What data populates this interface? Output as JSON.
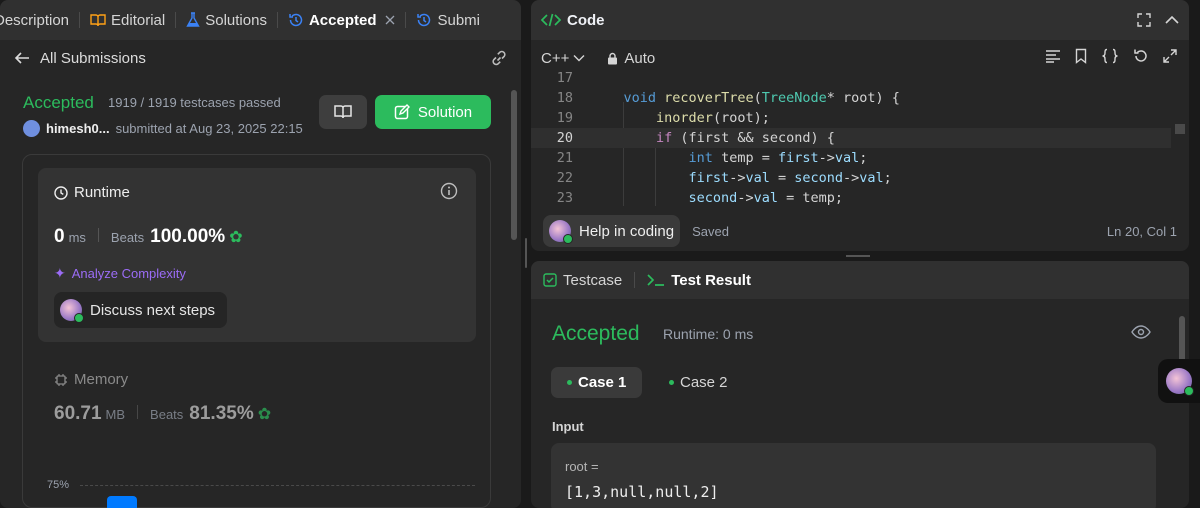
{
  "colors": {
    "accent_green": "#2cbb5d",
    "link_blue": "#3b82f6",
    "purple": "#9b6cf6",
    "chart_bar": "#007aff"
  },
  "left_tabs": [
    {
      "label": "Description",
      "icon": "description-icon"
    },
    {
      "label": "Editorial",
      "icon": "book-icon"
    },
    {
      "label": "Solutions",
      "icon": "flask-icon"
    },
    {
      "label": "Accepted",
      "icon": "history-icon"
    },
    {
      "label": "Submi",
      "icon": "history-icon"
    }
  ],
  "submission": {
    "back_label": "All Submissions",
    "status": "Accepted",
    "testcases": "1919 / 1919 testcases passed",
    "username": "himesh0...",
    "submitted": "submitted at Aug 23, 2025 22:15",
    "solution_button": "Solution",
    "runtime_title": "Runtime",
    "runtime_value": "0",
    "runtime_unit": "ms",
    "beats_label": "Beats",
    "runtime_beats": "100.00%",
    "analyze_label": "Analyze Complexity",
    "discuss_label": "Discuss next steps",
    "memory_title": "Memory",
    "memory_value": "60.71",
    "memory_unit": "MB",
    "memory_beats": "81.35%",
    "chart_tick": "75%"
  },
  "code_panel": {
    "title": "Code",
    "language": "C++",
    "mode": "Auto",
    "help_label": "Help in coding",
    "saved_label": "Saved",
    "cursor": "Ln 20, Col 1",
    "lines": [
      {
        "num": "17",
        "text": ""
      },
      {
        "num": "18",
        "text": "    void recoverTree(TreeNode* root) {"
      },
      {
        "num": "19",
        "text": "        inorder(root);"
      },
      {
        "num": "20",
        "text": "        if (first && second) {"
      },
      {
        "num": "21",
        "text": "            int temp = first->val;"
      },
      {
        "num": "22",
        "text": "            first->val = second->val;"
      },
      {
        "num": "23",
        "text": "            second->val = temp;"
      }
    ]
  },
  "test_panel": {
    "tab_testcase": "Testcase",
    "tab_result": "Test Result",
    "status": "Accepted",
    "runtime": "Runtime: 0 ms",
    "case1": "Case 1",
    "case2": "Case 2",
    "input_label": "Input",
    "var_name": "root =",
    "var_value": "[1,3,null,null,2]"
  }
}
